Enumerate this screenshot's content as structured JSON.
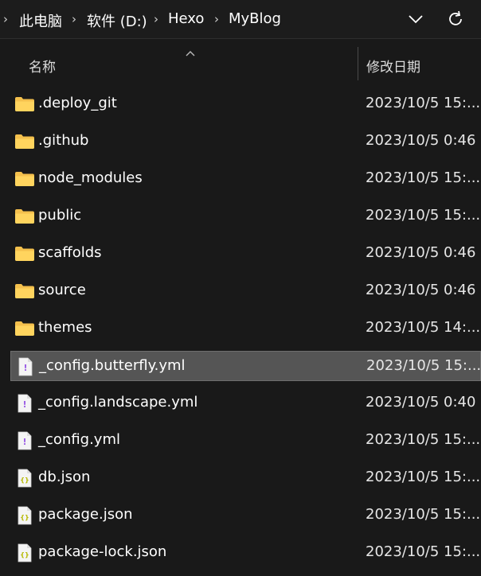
{
  "breadcrumb": {
    "items": [
      "此电脑",
      "软件 (D:)",
      "Hexo",
      "MyBlog"
    ]
  },
  "columns": {
    "name": "名称",
    "date": "修改日期"
  },
  "files": [
    {
      "name": ".deploy_git",
      "date": "2023/10/5 15:...",
      "type": "folder"
    },
    {
      "name": ".github",
      "date": "2023/10/5 0:46",
      "type": "folder"
    },
    {
      "name": "node_modules",
      "date": "2023/10/5 15:...",
      "type": "folder"
    },
    {
      "name": "public",
      "date": "2023/10/5 15:...",
      "type": "folder"
    },
    {
      "name": "scaffolds",
      "date": "2023/10/5 0:46",
      "type": "folder"
    },
    {
      "name": "source",
      "date": "2023/10/5 0:46",
      "type": "folder"
    },
    {
      "name": "themes",
      "date": "2023/10/5 14:...",
      "type": "folder"
    },
    {
      "name": "_config.butterfly.yml",
      "date": "2023/10/5 15:...",
      "type": "yml",
      "selected": true
    },
    {
      "name": "_config.landscape.yml",
      "date": "2023/10/5 0:40",
      "type": "yml"
    },
    {
      "name": "_config.yml",
      "date": "2023/10/5 15:...",
      "type": "yml"
    },
    {
      "name": "db.json",
      "date": "2023/10/5 15:...",
      "type": "json"
    },
    {
      "name": "package.json",
      "date": "2023/10/5 15:...",
      "type": "json"
    },
    {
      "name": "package-lock.json",
      "date": "2023/10/5 15:...",
      "type": "json"
    }
  ],
  "colors": {
    "background": "#191919",
    "selected_row": "#555555",
    "folder": "#f4c04d",
    "yml_mark": "#9b5de5",
    "json_mark": "#b5b800"
  }
}
